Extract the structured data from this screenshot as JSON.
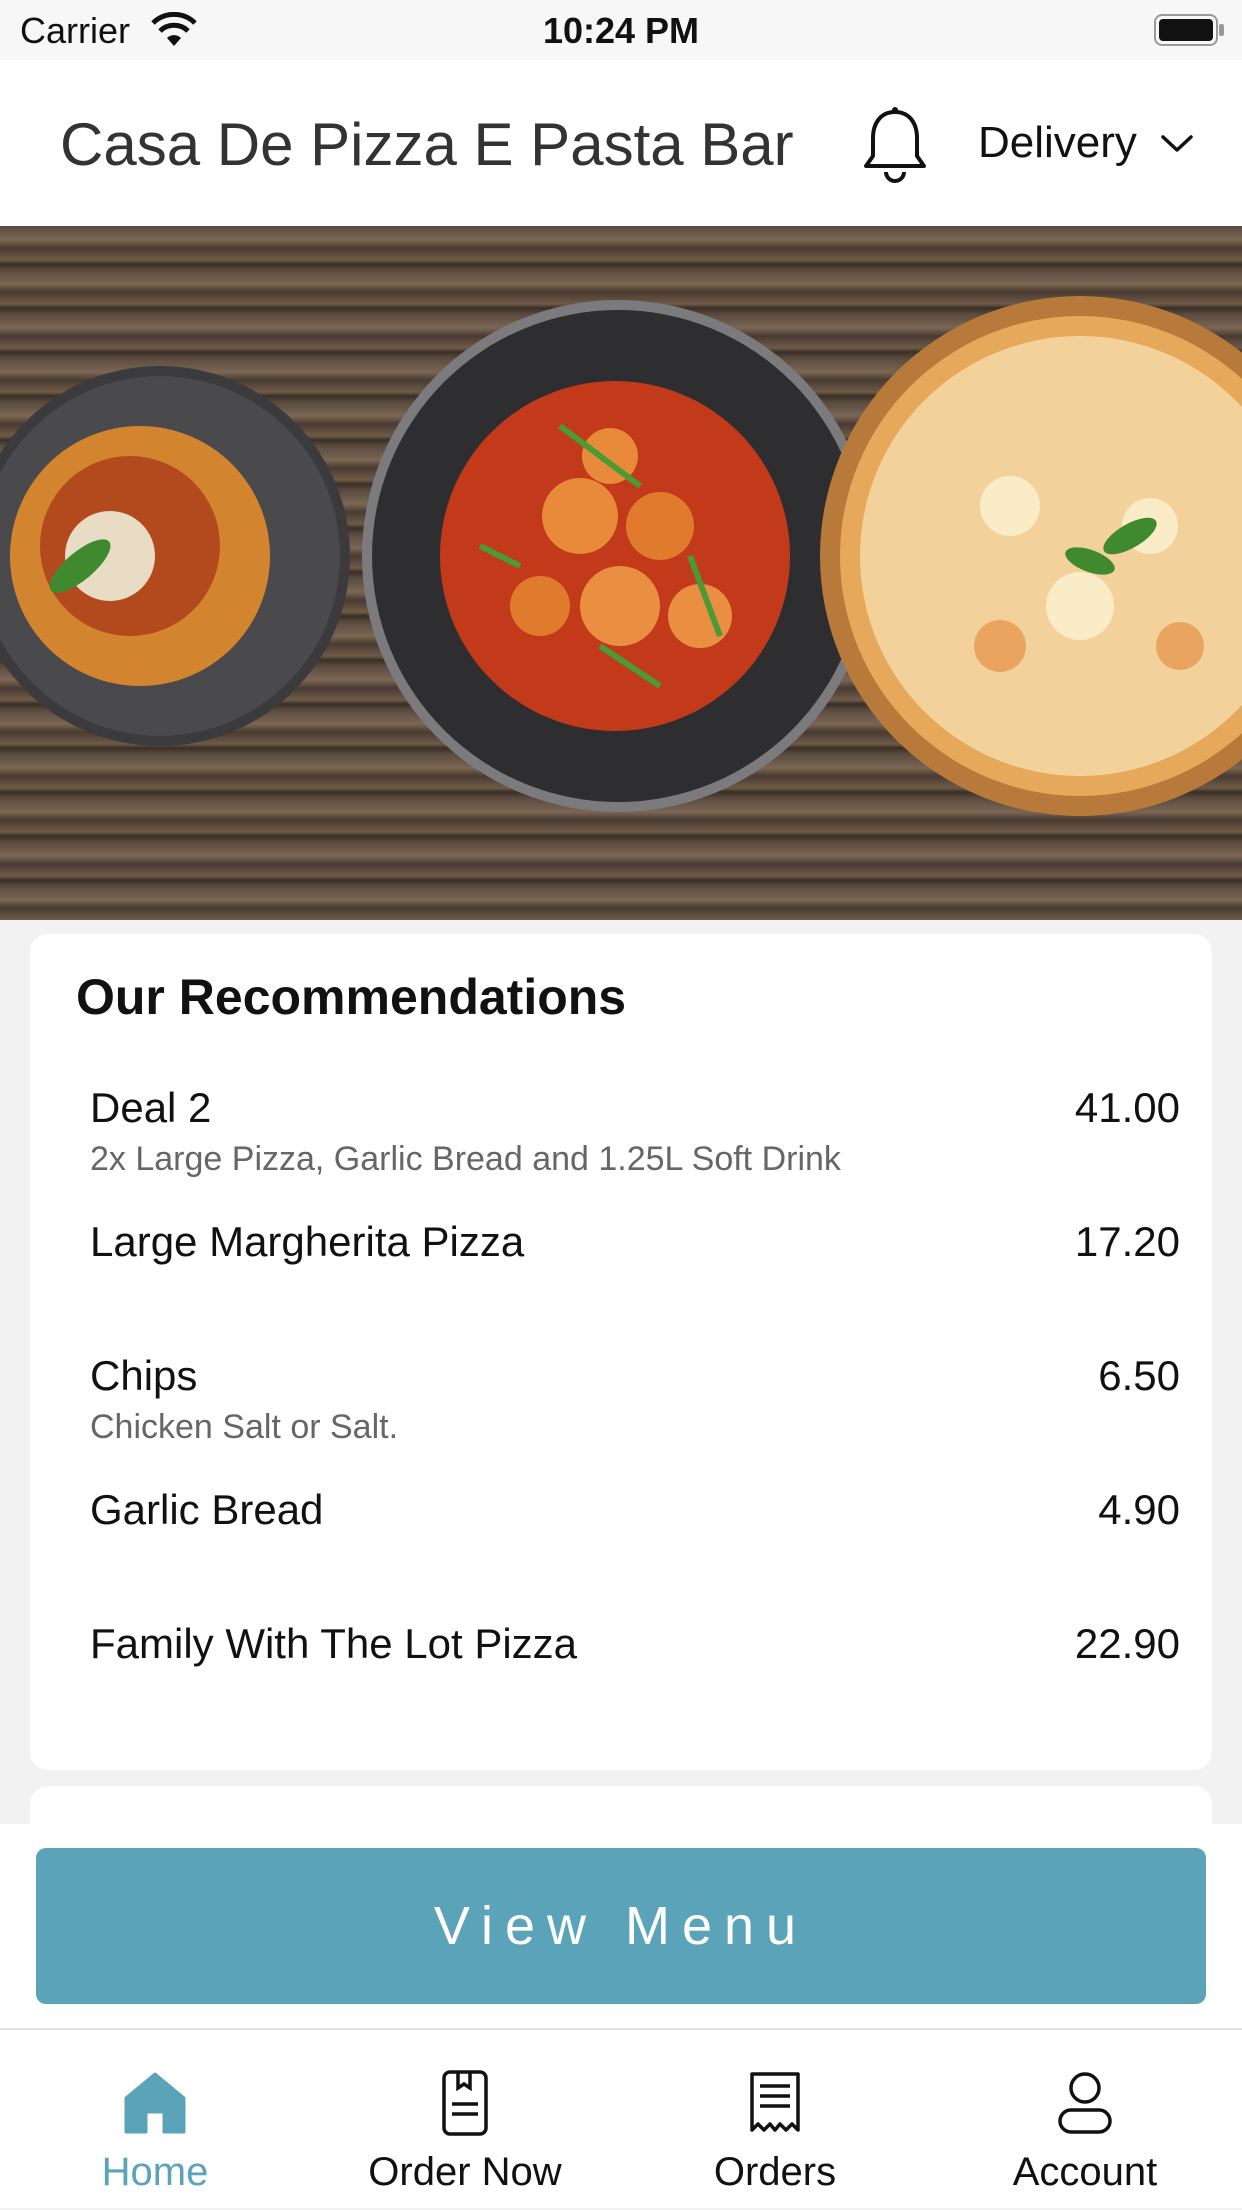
{
  "status_bar": {
    "carrier": "Carrier",
    "time": "10:24 PM",
    "wifi_icon": "wifi-icon",
    "battery_icon": "battery-icon"
  },
  "header": {
    "title": "Casa De Pizza E Pasta Bar",
    "notification_icon": "bell-icon",
    "order_type": "Delivery",
    "order_type_icon": "chevron-down-icon"
  },
  "recommendations": {
    "title": "Our Recommendations",
    "items": [
      {
        "name": "Deal 2",
        "description": "2x Large Pizza, Garlic Bread and 1.25L Soft Drink",
        "price": "41.00"
      },
      {
        "name": "Large Margherita Pizza",
        "description": "",
        "price": "17.20"
      },
      {
        "name": "Chips",
        "description": "Chicken Salt or Salt.",
        "price": "6.50"
      },
      {
        "name": "Garlic Bread",
        "description": "",
        "price": "4.90"
      },
      {
        "name": "Family With The Lot Pizza",
        "description": "",
        "price": "22.90"
      }
    ]
  },
  "view_menu_label": "View Menu",
  "tabs": [
    {
      "label": "Home",
      "icon": "home-icon",
      "active": true
    },
    {
      "label": "Order Now",
      "icon": "menu-book-icon",
      "active": false
    },
    {
      "label": "Orders",
      "icon": "receipt-icon",
      "active": false
    },
    {
      "label": "Account",
      "icon": "person-icon",
      "active": false
    }
  ],
  "colors": {
    "accent": "#5aa3b9",
    "background": "#f2f2f2"
  }
}
